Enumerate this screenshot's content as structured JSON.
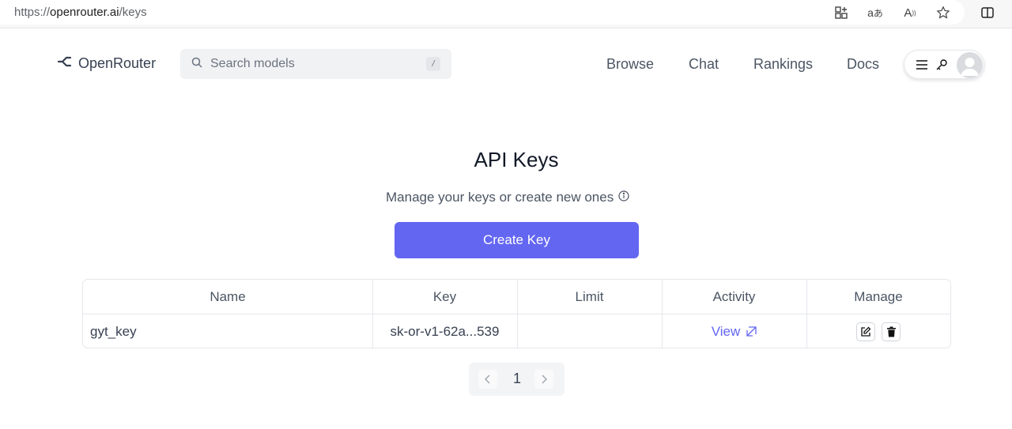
{
  "browser": {
    "url_prefix": "https://",
    "url_host": "openrouter.ai",
    "url_path": "/keys",
    "icons": [
      "apps-icon",
      "translate-icon",
      "read-aloud-icon",
      "favorite-star-icon",
      "split-screen-icon"
    ]
  },
  "header": {
    "logo_text": "OpenRouter",
    "search_placeholder": "Search models",
    "search_shortcut": "/",
    "nav": [
      "Browse",
      "Chat",
      "Rankings",
      "Docs"
    ]
  },
  "main": {
    "title": "API Keys",
    "subtitle": "Manage your keys or create new ones",
    "create_button": "Create Key",
    "accent_color": "#6366f1"
  },
  "table": {
    "columns": [
      "Name",
      "Key",
      "Limit",
      "Activity",
      "Manage"
    ],
    "rows": [
      {
        "name": "gyt_key",
        "key": "sk-or-v1-62a...539",
        "limit": "",
        "activity": "View"
      }
    ]
  },
  "pagination": {
    "current_page": "1"
  }
}
